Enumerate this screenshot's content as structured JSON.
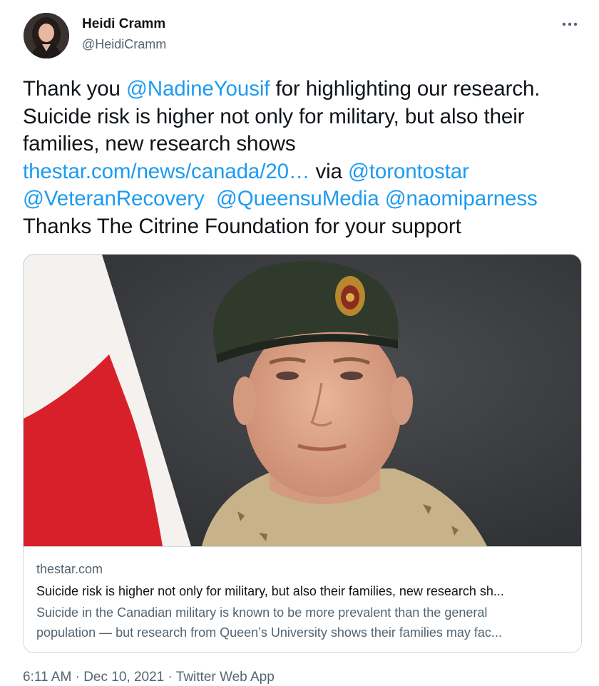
{
  "author": {
    "name": "Heidi Cramm",
    "handle": "@HeidiCramm"
  },
  "tweet": {
    "lines": [
      [
        {
          "text": "Thank you ",
          "type": "text"
        },
        {
          "text": "@NadineYousif",
          "type": "mention"
        },
        {
          "text": " for highlighting our research.",
          "type": "text"
        }
      ],
      [
        {
          "text": "Suicide risk is higher not only for military, but also their",
          "type": "text"
        }
      ],
      [
        {
          "text": "families, new research shows",
          "type": "text"
        }
      ],
      [
        {
          "text": "thestar.com/news/canada/20…",
          "type": "url"
        },
        {
          "text": " via ",
          "type": "text"
        },
        {
          "text": "@torontostar",
          "type": "mention"
        }
      ],
      [
        {
          "text": "@VeteranRecovery",
          "type": "mention"
        },
        {
          "text": "  ",
          "type": "text"
        },
        {
          "text": "@QueensuMedia",
          "type": "mention"
        },
        {
          "text": " ",
          "type": "text"
        },
        {
          "text": "@naomiparness",
          "type": "mention"
        }
      ],
      [
        {
          "text": "Thanks The Citrine Foundation for your support",
          "type": "text"
        }
      ]
    ]
  },
  "card": {
    "domain": "thestar.com",
    "title": "Suicide risk is higher not only for military, but also their families, new research sh...",
    "description_lines": [
      "Suicide in the Canadian military is known to be more prevalent than the general",
      "population — but research from Queen’s University shows their families may fac..."
    ]
  },
  "meta": {
    "time": "6:11 AM",
    "separator": " · ",
    "date": "Dec 10, 2021",
    "source": "Twitter Web App"
  },
  "colors": {
    "link": "#1d9bf0",
    "secondary_text": "#536471",
    "border": "#cfd9de"
  },
  "icons": {
    "more": "more-horizontal-icon"
  }
}
